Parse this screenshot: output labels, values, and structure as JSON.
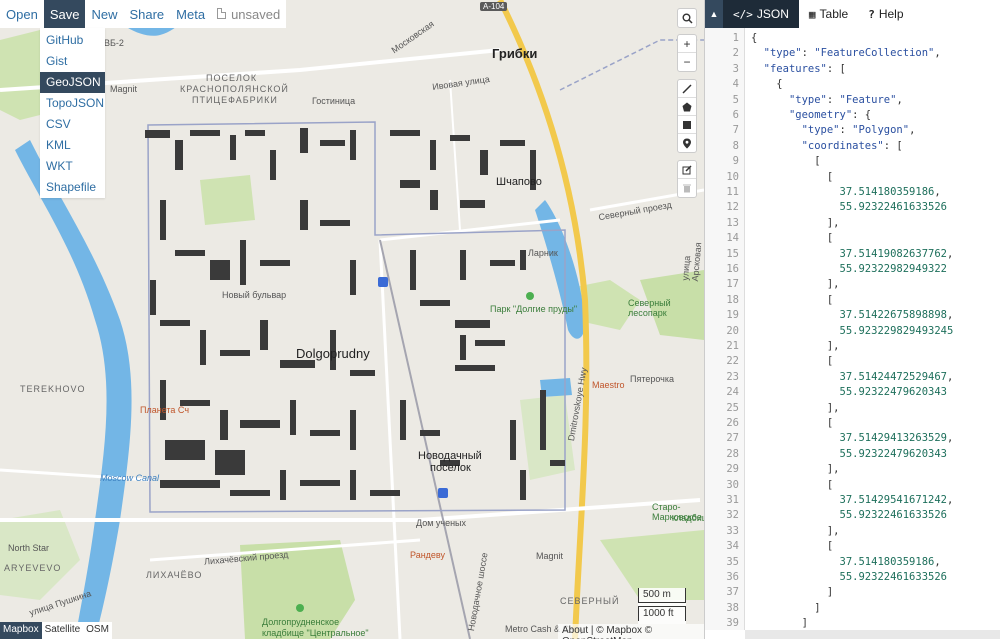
{
  "menu": {
    "items": [
      "Open",
      "Save",
      "New",
      "Share",
      "Meta"
    ],
    "active": "Save",
    "unsaved_label": "unsaved"
  },
  "save_dropdown": {
    "options": [
      "GitHub",
      "Gist",
      "GeoJSON",
      "TopoJSON",
      "CSV",
      "KML",
      "WKT",
      "Shapefile"
    ],
    "active": "GeoJSON"
  },
  "map": {
    "labels": {
      "gribki": "Грибки",
      "shchapovo": "Шчапово",
      "poselok": "ПОСЕЛОК",
      "krasnopolyanskoy": "КРАСНОПОЛЯНСКОЙ",
      "ptitsefabriki": "ПТИЦЕФАБРИКИ",
      "ivovaya": "Ивовая улица",
      "gostinitsa": "Гостиница",
      "magnit1": "Magnit",
      "magnit2": "Magnit",
      "dolgoprudny": "Dolgoprudny",
      "novy_bulvar": "Новый бульвар",
      "park": "Парк \"Долгие пруды\"",
      "severny_lesopark": "Северный лесопарк",
      "pyaterochka": "Пятерочка",
      "maestro": "Maestro",
      "planeta": "Планета Сч",
      "terekhovo": "TEREKHOVO",
      "moscow_canal": "Moscow Canal",
      "novodachny": "Новодачный",
      "poselok2": "поселок",
      "dom_uchenykh": "Дом ученых",
      "randevu": "Рандеву",
      "likhachevsky": "Лихачёвский проезд",
      "likhachevo": "ЛИХАЧЁВО",
      "north_star": "North Star",
      "arevevo": "ARYEVEVO",
      "ulitsa_pushkina": "улица Пушкина",
      "severny": "СЕВЕРНЫЙ",
      "dolgoprudnenskoe": "Долгопрудненское",
      "kladbishche": "кладбище \"Центральное\"",
      "metro": "Metro Cash & Carry",
      "staro_markovskoe": "Старо-Марковское",
      "kladbishche2": "кладбище",
      "dmitrovskoye": "Dmitrovskoye Hwy",
      "a104": "А-104",
      "larnik": "Ларник",
      "severny_proezd": "Северный проезд",
      "ulitsa_arskovaya": "улица Арсковая",
      "novodachnoe_shosse": "Новодачное шоссе",
      "vb2": "ВБ-2",
      "moskovskaya": "Московская"
    },
    "scale": {
      "metric": "500 m",
      "imperial": "1000 ft"
    },
    "layers": [
      "Mapbox",
      "Satellite",
      "OSM"
    ],
    "active_layer": "Mapbox",
    "attribution": "About | © Mapbox © OpenStreetMap",
    "controls": {
      "search": "search-icon",
      "zoom_in": "+",
      "zoom_out": "−",
      "draw_tools": [
        "line-icon",
        "polygon-icon",
        "rectangle-icon",
        "marker-icon"
      ],
      "edit_tools": [
        "edit-icon",
        "trash-icon"
      ]
    }
  },
  "panel": {
    "tabs": [
      {
        "label": "JSON",
        "icon": "</>"
      },
      {
        "label": "Table",
        "icon": "▦"
      },
      {
        "label": "Help",
        "icon": "?"
      }
    ],
    "active_tab": "JSON",
    "json_lines": [
      {
        "n": 1,
        "text": "{"
      },
      {
        "n": 2,
        "text": "  \"type\": \"FeatureCollection\","
      },
      {
        "n": 3,
        "text": "  \"features\": ["
      },
      {
        "n": 4,
        "text": "    {"
      },
      {
        "n": 5,
        "text": "      \"type\": \"Feature\","
      },
      {
        "n": 6,
        "text": "      \"geometry\": {"
      },
      {
        "n": 7,
        "text": "        \"type\": \"Polygon\","
      },
      {
        "n": 8,
        "text": "        \"coordinates\": ["
      },
      {
        "n": 9,
        "text": "          ["
      },
      {
        "n": 10,
        "text": "            ["
      },
      {
        "n": 11,
        "text": "              37.514180359186,"
      },
      {
        "n": 12,
        "text": "              55.92322461633526"
      },
      {
        "n": 13,
        "text": "            ],"
      },
      {
        "n": 14,
        "text": "            ["
      },
      {
        "n": 15,
        "text": "              37.51419082637762,"
      },
      {
        "n": 16,
        "text": "              55.92322982949322"
      },
      {
        "n": 17,
        "text": "            ],"
      },
      {
        "n": 18,
        "text": "            ["
      },
      {
        "n": 19,
        "text": "              37.51422675898898,"
      },
      {
        "n": 20,
        "text": "              55.923229829493245"
      },
      {
        "n": 21,
        "text": "            ],"
      },
      {
        "n": 22,
        "text": "            ["
      },
      {
        "n": 23,
        "text": "              37.51424472529467,"
      },
      {
        "n": 24,
        "text": "              55.92322479620343"
      },
      {
        "n": 25,
        "text": "            ],"
      },
      {
        "n": 26,
        "text": "            ["
      },
      {
        "n": 27,
        "text": "              37.51429413263529,"
      },
      {
        "n": 28,
        "text": "              55.92322479620343"
      },
      {
        "n": 29,
        "text": "            ],"
      },
      {
        "n": 30,
        "text": "            ["
      },
      {
        "n": 31,
        "text": "              37.51429541671242,"
      },
      {
        "n": 32,
        "text": "              55.92322461633526"
      },
      {
        "n": 33,
        "text": "            ],"
      },
      {
        "n": 34,
        "text": "            ["
      },
      {
        "n": 35,
        "text": "              37.514180359186,"
      },
      {
        "n": 36,
        "text": "              55.92322461633526"
      },
      {
        "n": 37,
        "text": "            ]"
      },
      {
        "n": 38,
        "text": "          ]"
      },
      {
        "n": 39,
        "text": "        ]"
      }
    ]
  },
  "colors": {
    "menu_active": "#34495e",
    "link": "#2f6ea3",
    "water": "#73b6e6",
    "park": "#c8dfa8",
    "building": "#3a3a3a",
    "highway": "#f2c94c",
    "json_key": "#2a4fa0",
    "json_number": "#1d6f5b"
  }
}
